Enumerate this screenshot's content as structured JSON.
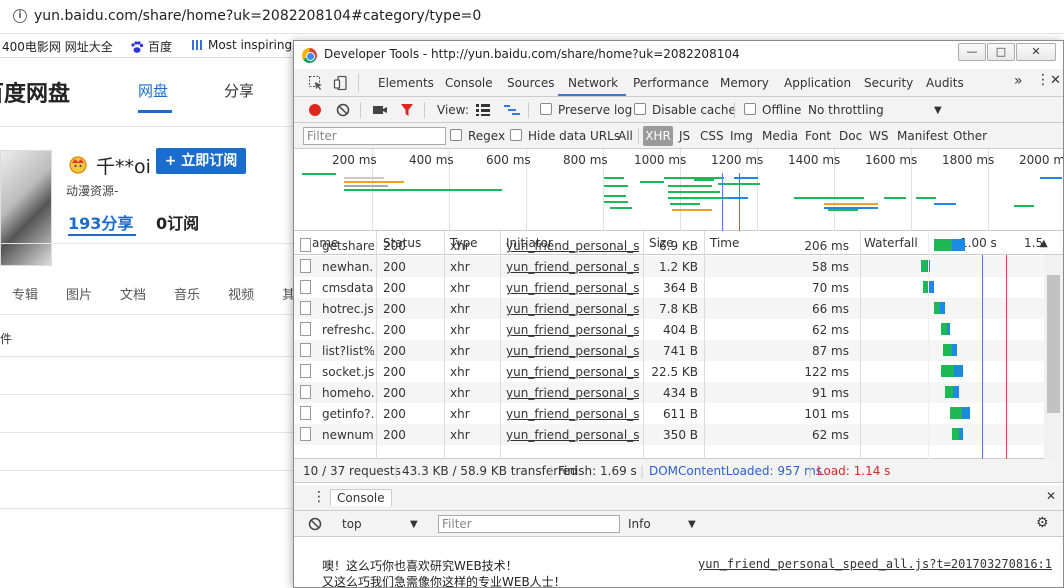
{
  "browser": {
    "url": "yun.baidu.com/share/home?uk=2082208104#category/type=0",
    "bookmarks": [
      "400电影网 网址大全",
      "百度",
      "Most inspiring"
    ]
  },
  "page": {
    "brand": "百度网盘",
    "nav_active": "网盘",
    "nav_other": "分享",
    "user_name": "千**oi",
    "subscribe_label": "+ 立即订阅",
    "bio": "动漫资源-",
    "shares_label": "193分享",
    "subs_label": "0订阅",
    "categories": [
      "专辑",
      "图片",
      "文档",
      "音乐",
      "视频",
      "其他"
    ],
    "file_col_label": "件"
  },
  "devtools": {
    "window_title": "Developer Tools - http://yun.baidu.com/share/home?uk=2082208104",
    "tabs": [
      "Elements",
      "Console",
      "Sources",
      "Network",
      "Performance",
      "Memory",
      "Application",
      "Security",
      "Audits"
    ],
    "active_tab": "Network",
    "toolbar": {
      "view_label": "View:",
      "preserve_log": "Preserve log",
      "disable_cache": "Disable cache",
      "offline": "Offline",
      "throttling": "No throttling"
    },
    "filter": {
      "placeholder": "Filter",
      "regex": "Regex",
      "hide_data_urls": "Hide data URLs",
      "types": [
        "All",
        "XHR",
        "JS",
        "CSS",
        "Img",
        "Media",
        "Font",
        "Doc",
        "WS",
        "Manifest",
        "Other"
      ],
      "active_type": "XHR"
    },
    "overview_ticks": [
      "200 ms",
      "400 ms",
      "600 ms",
      "800 ms",
      "1000 ms",
      "1200 ms",
      "1400 ms",
      "1600 ms",
      "1800 ms",
      "2000 ms"
    ],
    "columns": [
      "Name",
      "Status",
      "Type",
      "Initiator",
      "Size",
      "Time",
      "Waterfall"
    ],
    "waterfall_ticks": [
      "1.00 s",
      "1.5"
    ],
    "rows": [
      {
        "name": "getshare...",
        "status": "200",
        "type": "xhr",
        "initiator": "yun_friend_personal_sp...",
        "size": "6.9 KB",
        "time": "206 ms",
        "wf_start": 0.4,
        "wf_len": 0.17
      },
      {
        "name": "newhan...",
        "status": "200",
        "type": "xhr",
        "initiator": "yun_friend_personal_sp...",
        "size": "1.2 KB",
        "time": "58 ms",
        "wf_start": 0.33,
        "wf_len": 0.05
      },
      {
        "name": "cmsdata...",
        "status": "200",
        "type": "xhr",
        "initiator": "yun_friend_personal_sp...",
        "size": "364 B",
        "time": "70 ms",
        "wf_start": 0.34,
        "wf_len": 0.06
      },
      {
        "name": "hotrec.js...",
        "status": "200",
        "type": "xhr",
        "initiator": "yun_friend_personal_sp...",
        "size": "7.8 KB",
        "time": "66 ms",
        "wf_start": 0.4,
        "wf_len": 0.06
      },
      {
        "name": "refreshc...",
        "status": "200",
        "type": "xhr",
        "initiator": "yun_friend_personal_sp...",
        "size": "404 B",
        "time": "62 ms",
        "wf_start": 0.44,
        "wf_len": 0.05
      },
      {
        "name": "list?list%...",
        "status": "200",
        "type": "xhr",
        "initiator": "yun_friend_personal_sp...",
        "size": "741 B",
        "time": "87 ms",
        "wf_start": 0.45,
        "wf_len": 0.08
      },
      {
        "name": "socket.js...",
        "status": "200",
        "type": "xhr",
        "initiator": "yun_friend_personal_sp...",
        "size": "22.5 KB",
        "time": "122 ms",
        "wf_start": 0.44,
        "wf_len": 0.12
      },
      {
        "name": "homeho...",
        "status": "200",
        "type": "xhr",
        "initiator": "yun_friend_personal_sp...",
        "size": "434 B",
        "time": "91 ms",
        "wf_start": 0.46,
        "wf_len": 0.08
      },
      {
        "name": "getinfo?...",
        "status": "200",
        "type": "xhr",
        "initiator": "yun_friend_personal_sp...",
        "size": "611 B",
        "time": "101 ms",
        "wf_start": 0.49,
        "wf_len": 0.11
      },
      {
        "name": "newnum...",
        "status": "200",
        "type": "xhr",
        "initiator": "yun_friend_personal_sp...",
        "size": "350 B",
        "time": "62 ms",
        "wf_start": 0.5,
        "wf_len": 0.06
      }
    ],
    "status": {
      "requests": "10 / 37 requests",
      "transferred": "43.3 KB / 58.9 KB transferred",
      "finish": "Finish: 1.69 s",
      "dcl": "DOMContentLoaded: 957 ms",
      "load": "Load: 1.14 s"
    },
    "console": {
      "tab_label": "Console",
      "context": "top",
      "filter_placeholder": "Filter",
      "level": "Info",
      "messages": [
        "噢！这么巧你也喜欢研究WEB技术！",
        "又这么巧我们急需像你这样的专业WEB人士！"
      ],
      "source": "yun_friend_personal_speed_all.js?t=201703270816:1"
    },
    "colors": {
      "accent": "#3879d9",
      "record": "#e0261b",
      "dcl": "#4a7ef5",
      "load": "#e44444",
      "wf_green": "#1db954",
      "wf_blue": "#1e88e5"
    }
  }
}
